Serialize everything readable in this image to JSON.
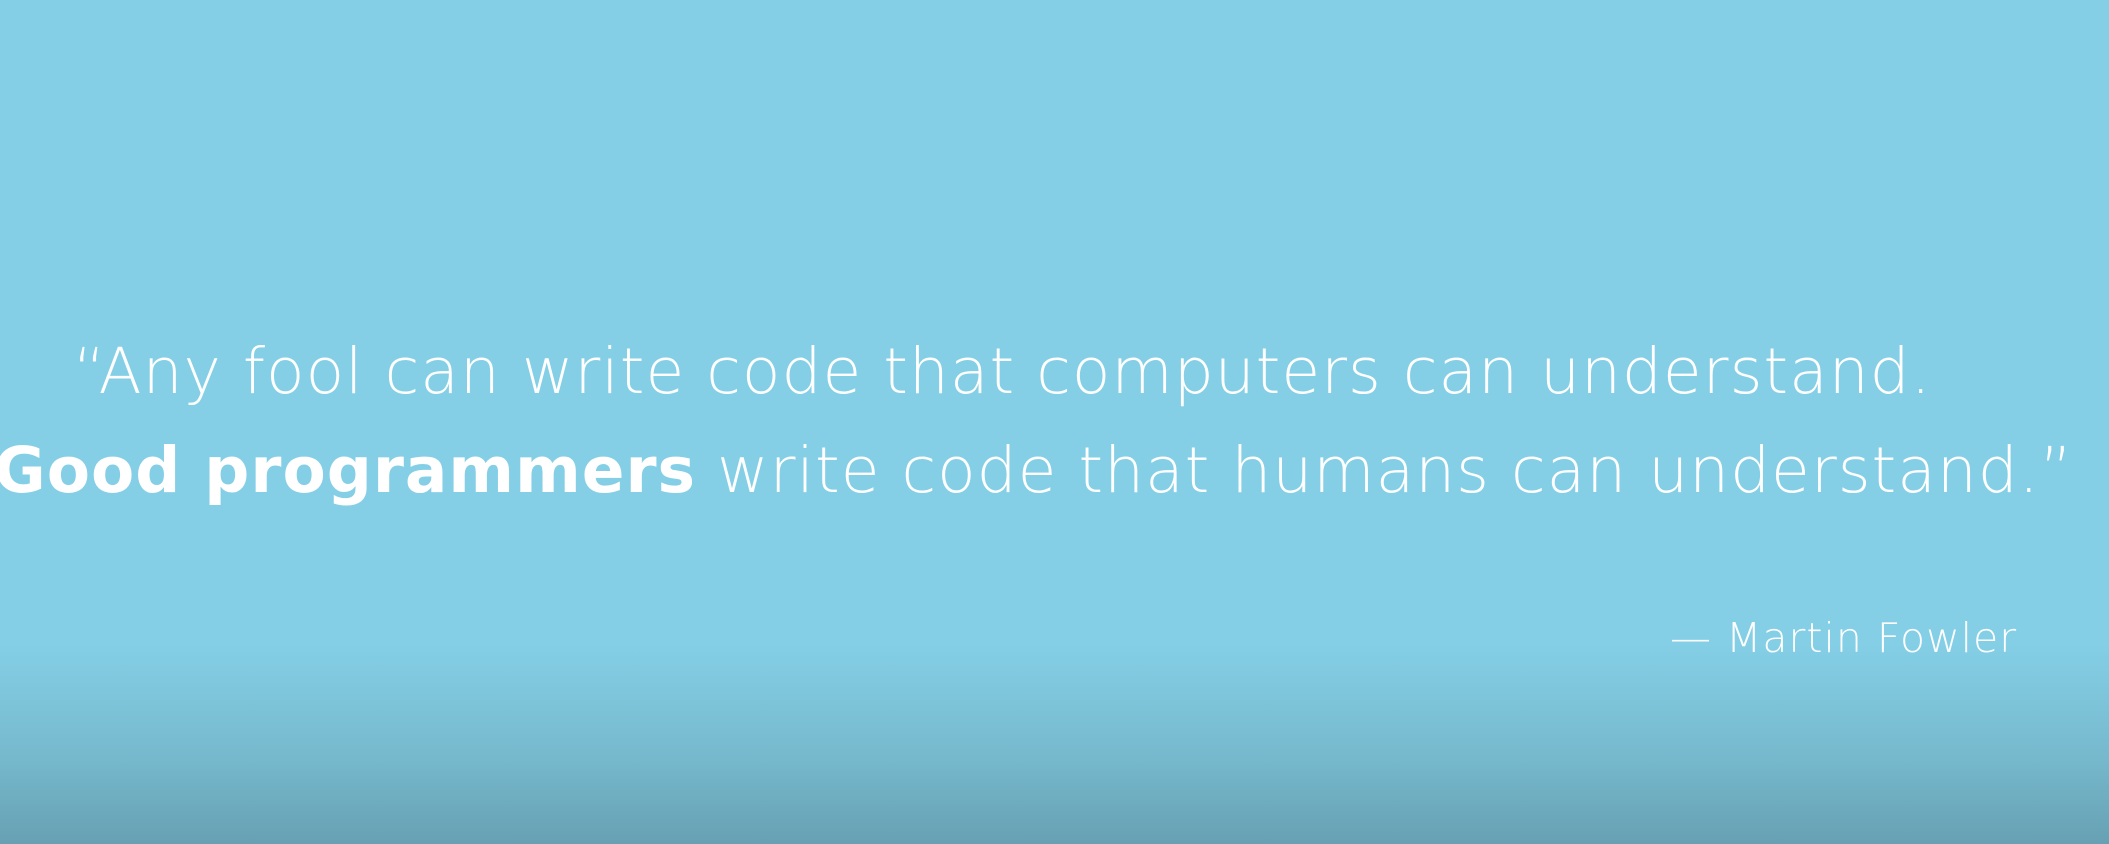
{
  "quote": {
    "line1": "“Any fool can write code that computers can understand.",
    "line2_emphasis": "Good programmers",
    "line2_rest": " write code that humans can understand.”"
  },
  "attribution": {
    "text": "— Martin Fowler"
  },
  "colors": {
    "background": "#84cfe6",
    "text": "#ffffff",
    "bottom_shade": "#6298aa"
  }
}
